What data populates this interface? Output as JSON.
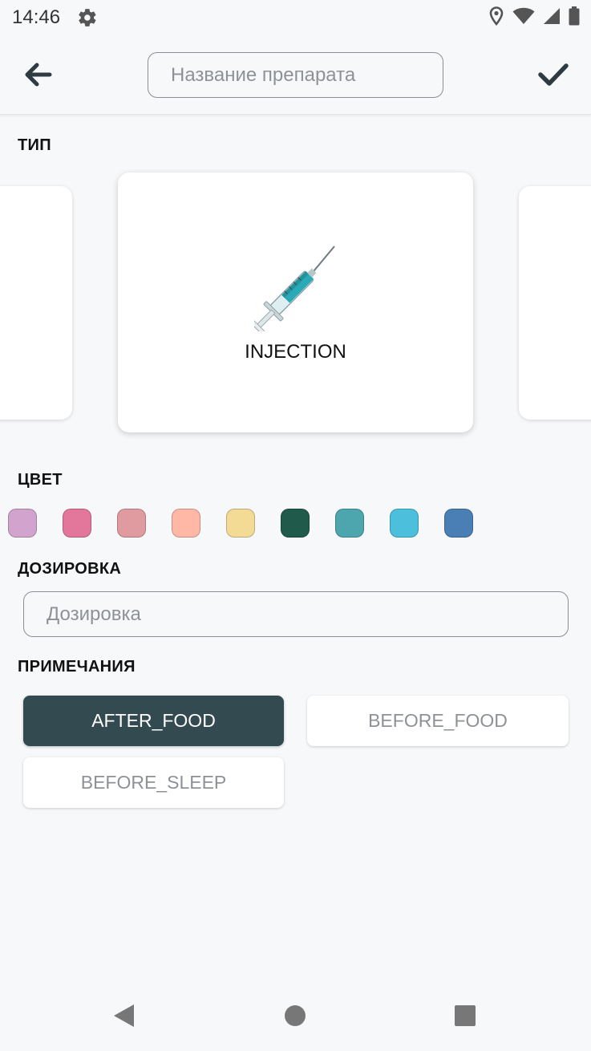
{
  "status_bar": {
    "time": "14:46",
    "icons": [
      "settings-gear-icon",
      "location-icon",
      "wifi-icon",
      "signal-icon",
      "battery-icon"
    ]
  },
  "app_bar": {
    "back_icon": "arrow-left-icon",
    "name_placeholder": "Название препарата",
    "name_value": "",
    "confirm_icon": "checkmark-icon"
  },
  "type_section": {
    "label": "ТИП",
    "selected": {
      "label": "INJECTION",
      "icon": "syringe-icon"
    }
  },
  "color_section": {
    "label": "ЦВЕТ",
    "colors": [
      "#d2a3cc",
      "#e2779b",
      "#e09ba0",
      "#ffb8a6",
      "#f3da95",
      "#1f5a4b",
      "#4da6ad",
      "#4bbfdc",
      "#4a7fb5"
    ]
  },
  "dosage_section": {
    "label": "ДОЗИРОВКА",
    "placeholder": "Дозировка",
    "value": ""
  },
  "notes_section": {
    "label": "ПРИМЕЧАНИЯ",
    "chips": [
      {
        "label": "AFTER_FOOD",
        "selected": true
      },
      {
        "label": "BEFORE_FOOD",
        "selected": false
      },
      {
        "label": "BEFORE_SLEEP",
        "selected": false
      }
    ]
  },
  "colors": {
    "background": "#f7f8fa",
    "accent_dark": "#334a50",
    "icon_dark": "#2f3b42"
  },
  "nav_bar": {
    "icons": [
      "back-triangle-icon",
      "home-circle-icon",
      "recents-square-icon"
    ]
  }
}
